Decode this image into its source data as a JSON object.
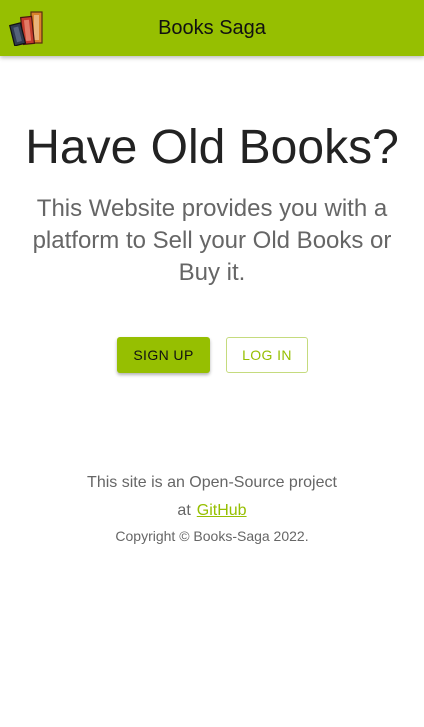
{
  "colors": {
    "accent": "#96bf01",
    "text_dark": "#222222",
    "text_muted": "#666666"
  },
  "header": {
    "logo_icon": "books-logo-icon",
    "title": "Books Saga"
  },
  "hero": {
    "title": "Have Old Books?",
    "subtitle": "This Website provides you with a platform to Sell your Old Books or Buy it."
  },
  "actions": {
    "signup_label": "SIGN UP",
    "login_label": "LOG IN"
  },
  "footer": {
    "line1": "This site is an Open-Source project",
    "at_text": "at",
    "link_label": "GitHub",
    "copyright": "Copyright © Books-Saga 2022."
  }
}
